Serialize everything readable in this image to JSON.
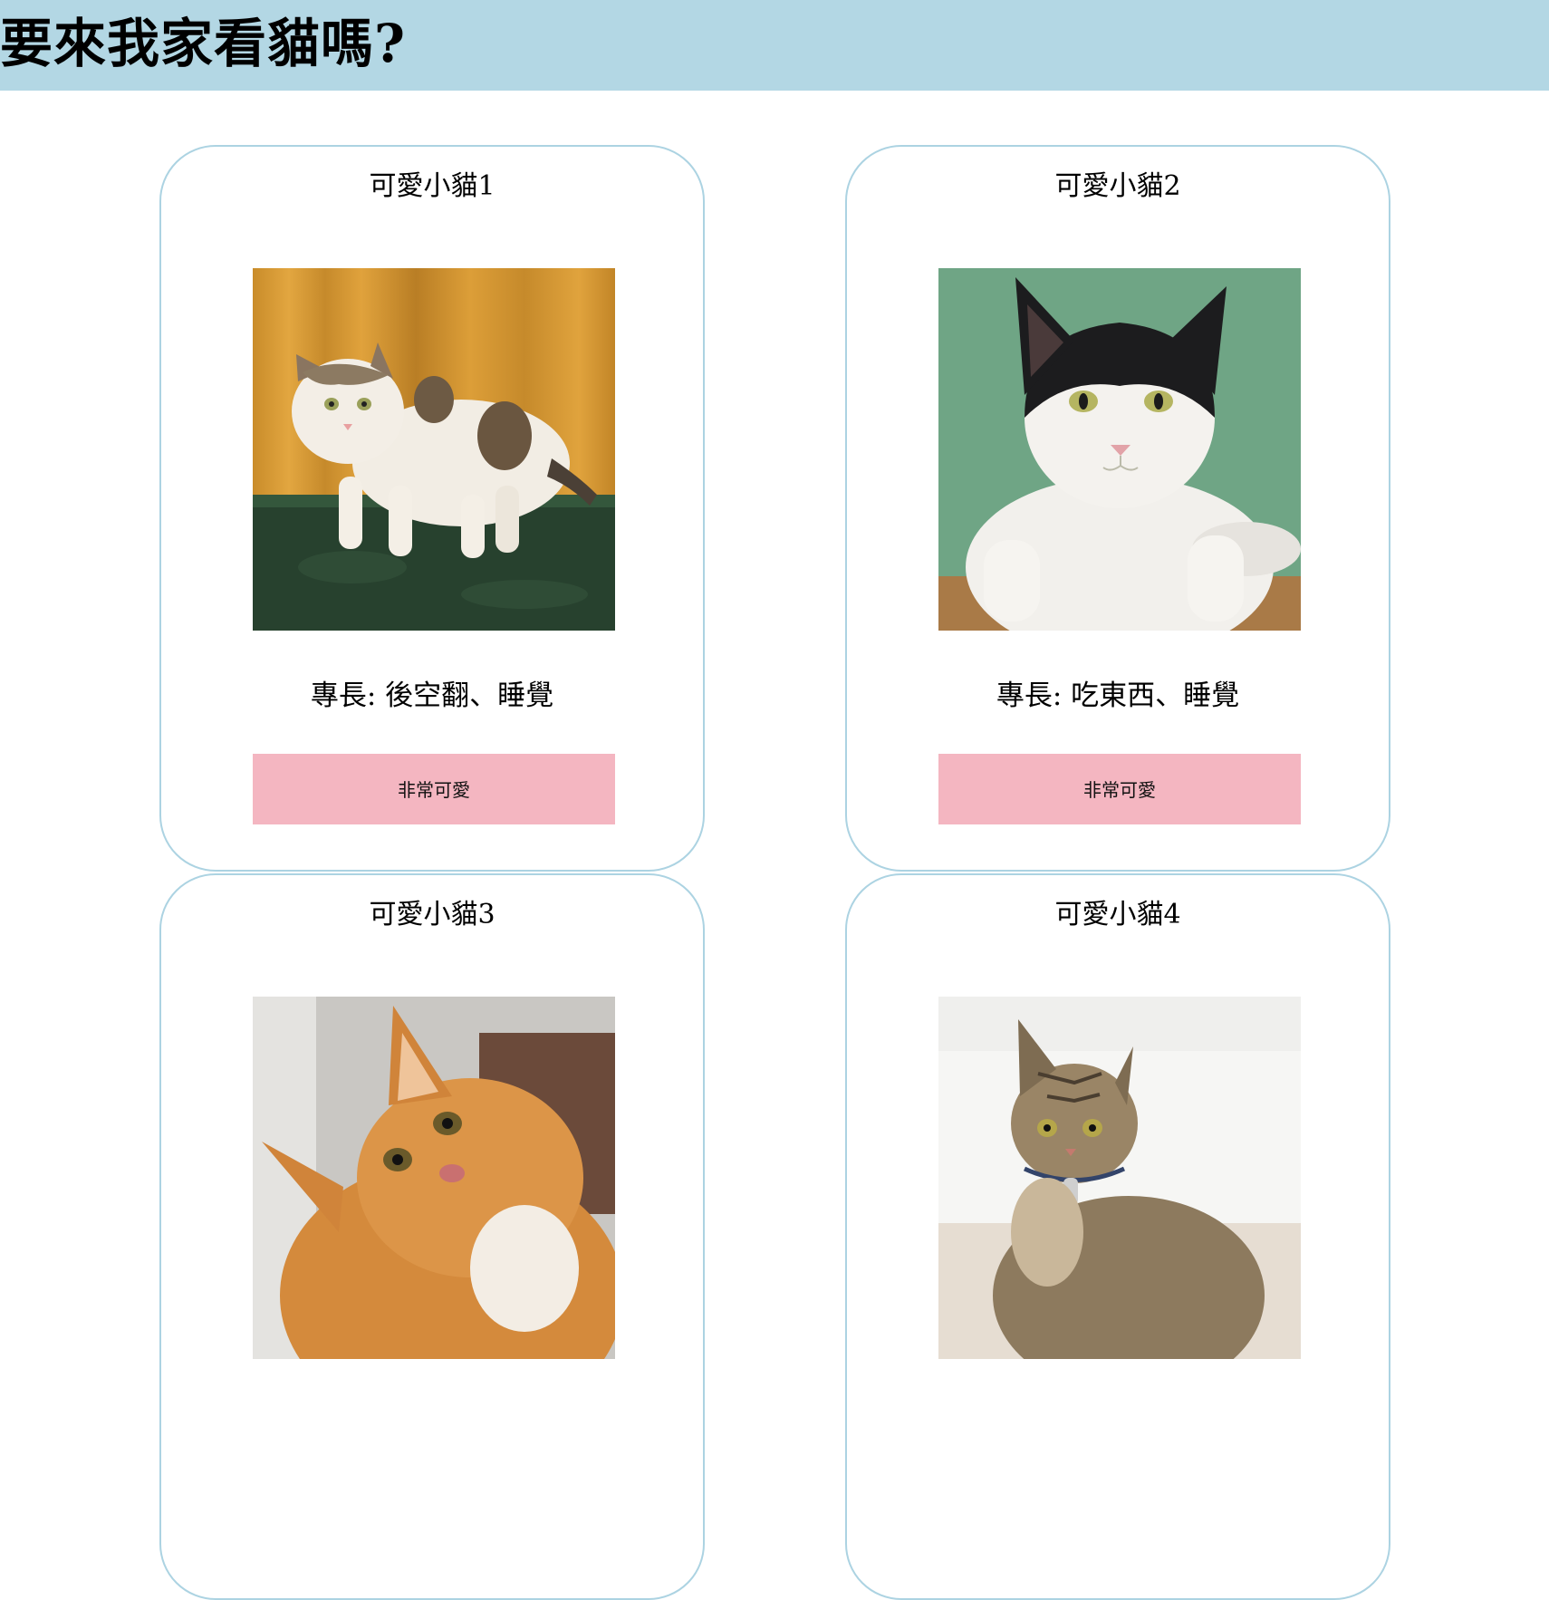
{
  "header": {
    "title": "要來我家看貓嗎?"
  },
  "cards": [
    {
      "title": "可愛小貓1",
      "skill": "專長: 後空翻、睡覺",
      "button": "非常可愛"
    },
    {
      "title": "可愛小貓2",
      "skill": "專長: 吃東西、睡覺",
      "button": "非常可愛"
    },
    {
      "title": "可愛小貓3",
      "skill": "",
      "button": ""
    },
    {
      "title": "可愛小貓4",
      "skill": "",
      "button": ""
    }
  ],
  "colors": {
    "header_bg": "#b3d7e4",
    "card_border": "#acd3e2",
    "button_bg": "#f4b6c1"
  }
}
